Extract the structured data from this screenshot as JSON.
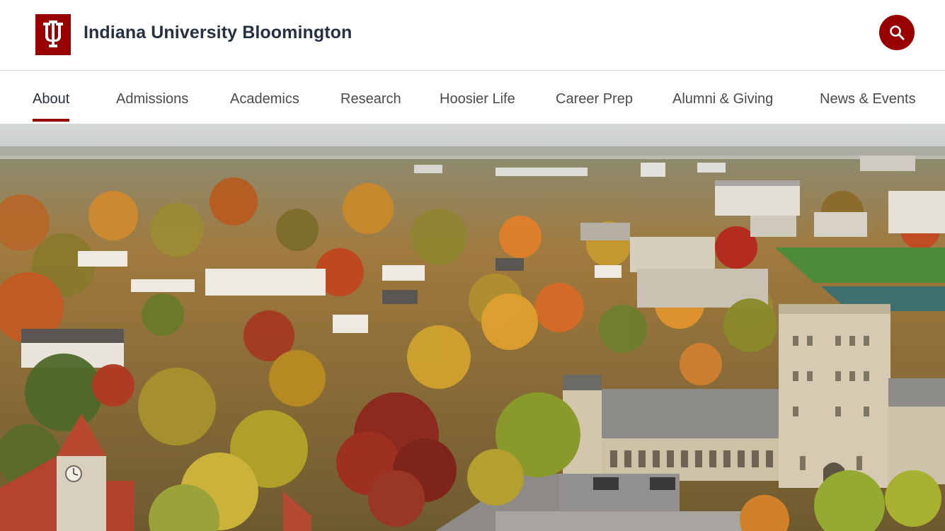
{
  "site": {
    "title": "Indiana University Bloomington",
    "logo_icon": "iu-trident-icon",
    "brand_color": "#990000"
  },
  "search": {
    "icon": "search-icon"
  },
  "nav": {
    "items": [
      {
        "label": "About",
        "active": true
      },
      {
        "label": "Admissions"
      },
      {
        "label": "Academics"
      },
      {
        "label": "Research"
      },
      {
        "label": "Hoosier Life"
      },
      {
        "label": "Career Prep"
      },
      {
        "label": "Alumni & Giving"
      },
      {
        "label": "News & Events"
      }
    ]
  },
  "hero": {
    "image": "aerial-campus-autumn-photo"
  }
}
